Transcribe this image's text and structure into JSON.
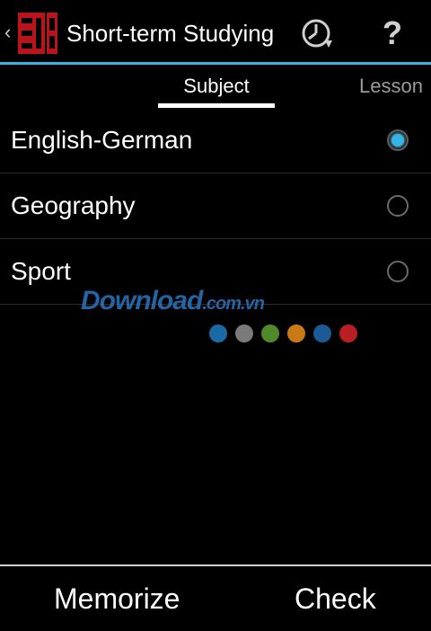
{
  "actionbar": {
    "title": "Short-term Studying",
    "up_caret": "‹",
    "logo_icon": "mm-logo-icon",
    "history_icon": "clock-refresh-icon",
    "help_label": "?",
    "accent_color": "#33b5e5"
  },
  "tabs": {
    "subject": "Subject",
    "lesson": "Lesson",
    "active": "Subject"
  },
  "subjects": [
    {
      "label": "English-German",
      "checked": true
    },
    {
      "label": "Geography",
      "checked": false
    },
    {
      "label": "Sport",
      "checked": false
    }
  ],
  "watermark": {
    "text": "Download",
    "suffix": ".com.vn",
    "dot_colors": [
      "#1b6aa5",
      "#7a7a7a",
      "#4f8a2a",
      "#c97a17",
      "#1b5a95",
      "#b81e23"
    ]
  },
  "bottom": {
    "memorize": "Memorize",
    "check": "Check"
  }
}
